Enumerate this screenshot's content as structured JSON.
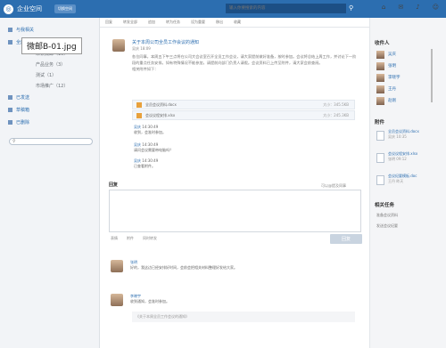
{
  "app": {
    "title": "企业空间",
    "switch_label": "切换空间"
  },
  "top": {
    "search_placeholder": "输入你要搜索的内容"
  },
  "caption": "微邮B-01.jpg",
  "sidebar": {
    "items": [
      {
        "label": "与我相关"
      },
      {
        "label": "全部微邮"
      },
      {
        "label": "未读微邮（10）"
      },
      {
        "label": "产品业务（3）"
      },
      {
        "label": "测试（1）"
      },
      {
        "label": "市场推广（12）"
      },
      {
        "label": "已发送"
      },
      {
        "label": "草稿箱"
      },
      {
        "label": "已删除"
      }
    ]
  },
  "toolbar": {
    "items": [
      "回复",
      "转发全部",
      "追加",
      "转为任务",
      "设为重要",
      "移出",
      "收藏"
    ]
  },
  "post": {
    "title": "关于本周公司全员工作会议的通知",
    "author": "吴庆 18:09",
    "body": "各位同事，本周五下午三点将在公司大会议室召开全员工作会议，请大家提前做好准备，按时参加。会议将总结上周工作，并讨论下一阶段的重点任务安排。如有特殊情况不能参加，请提前向部门负责人请假。会议资料已上传至附件，请大家会前查阅。",
    "extra": "相关附件如下："
  },
  "attachments": [
    {
      "name": "全员会议资料.docx",
      "size": "大小：345.5KB"
    },
    {
      "name": "会议议程安排.xlsx",
      "size": "大小：245.3KB"
    }
  ],
  "replies": [
    {
      "who": "吴庆",
      "time": "14:30:49",
      "text": "收到，会准时参加。"
    },
    {
      "who": "吴庆",
      "time": "14:30:49",
      "text": "请问会议需要带电脑吗？"
    },
    {
      "who": "吴庆",
      "time": "14:30:49",
      "text": "已查看附件。"
    }
  ],
  "reply_section": {
    "title": "回复",
    "hint": "可以@提及同事",
    "send": "回复",
    "opts": [
      "表情",
      "附件",
      "同时转发"
    ]
  },
  "followups": [
    {
      "name": "张明",
      "text": "好的，我这边已经安排好时间，会前会把相关材料整理好发给大家。"
    },
    {
      "name": "李晓宇",
      "text": "收到通知，会准时参加。",
      "quote": "《关于本周全员工作会议的通知》"
    }
  ],
  "right": {
    "people_title": "收件人",
    "people": [
      "吴庆",
      "张明",
      "李晓宇",
      "王丹",
      "赵刚"
    ],
    "docs_title": "附件",
    "docs": [
      {
        "name": "全员会议资料.docx",
        "meta": "吴庆 10:35"
      },
      {
        "name": "会议议程安排.xlsx",
        "meta": "张明 09:12"
      },
      {
        "name": "会议纪要模板.doc",
        "meta": "王丹 昨天"
      }
    ],
    "tasks_title": "相关任务",
    "tasks": [
      "准备会议资料",
      "发送会议纪要"
    ]
  }
}
